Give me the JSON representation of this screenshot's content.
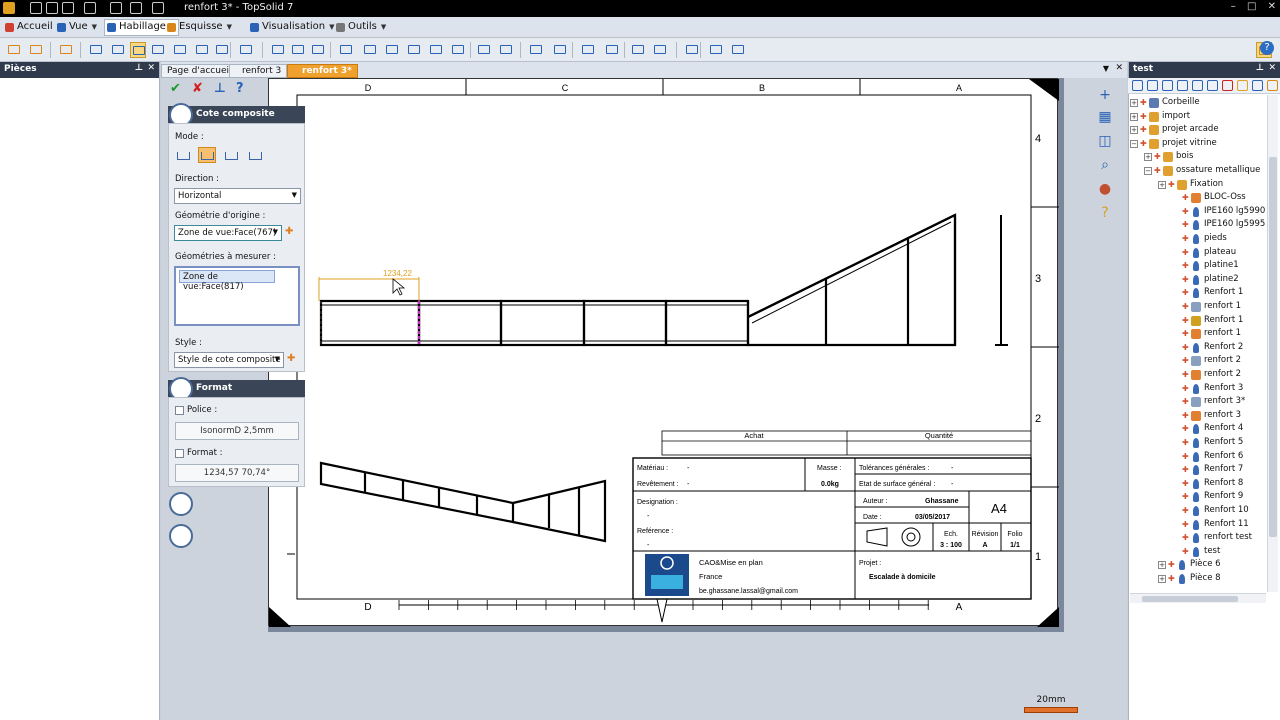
{
  "window": {
    "title": "renfort 3* - TopSolid 7",
    "controls": [
      "–",
      "□",
      "✕"
    ]
  },
  "menubar": [
    {
      "label": "Accueil",
      "color": "#d04030"
    },
    {
      "label": "Vue",
      "color": "#2a62b6"
    },
    {
      "label": "Habillage",
      "color": "#2a62b6",
      "active": true
    },
    {
      "label": "Esquisse",
      "color": "#d9861a"
    },
    {
      "label": "Visualisation",
      "color": "#2a62b6"
    },
    {
      "label": "Outils",
      "color": "#777777"
    }
  ],
  "left_pane": {
    "title": "Pièces"
  },
  "doc_tabs": [
    {
      "label": "Page d'accueil"
    },
    {
      "label": "renfort 3"
    },
    {
      "label": "renfort 3*",
      "active": true
    }
  ],
  "panel": {
    "section1_title": "Cote composite",
    "mode_label": "Mode :",
    "direction_label": "Direction :",
    "direction_value": "Horizontal",
    "origin_label": "Géométrie d'origine :",
    "origin_value": "Zone de vue:Face(767)",
    "measure_label": "Géométries à mesurer :",
    "measure_items": [
      "Zone de vue:Face(817)"
    ],
    "style_label": "Style :",
    "style_value": "Style de cote composite",
    "section2_title": "Format",
    "police_label": "Police :",
    "police_value": "IsonormD 2,5mm",
    "format_label": "Format :",
    "format_value": "1234,57   70,74°"
  },
  "drawing": {
    "dimension_text": "1234,22",
    "top_letters": [
      "D",
      "C",
      "B",
      "A"
    ],
    "bottom_letters": [
      "D",
      "A"
    ],
    "row_numbers": [
      "4",
      "3",
      "2",
      "1"
    ],
    "achat": "Achat",
    "quantite": "Quantité",
    "materiau_label": "Matériau :",
    "materiau_value": "-",
    "revetement_label": "Revêtement :",
    "revetement_value": "-",
    "masse_label": "Masse :",
    "masse_value": "0.0kg",
    "tolerances_label": "Tolérances générales :",
    "tolerances_value": "-",
    "etat_label": "Etat de surface général :",
    "etat_value": "-",
    "designation_label": "Designation :",
    "designation_value": "-",
    "reference_label": "Reférence :",
    "reference_value": "-",
    "auteur_label": "Auteur :",
    "auteur_value": "Ghassane",
    "date_label": "Date :",
    "date_value": "03/05/2017",
    "format_size": "A4",
    "ech_label": "Ech.",
    "ech_value": "3 : 100",
    "revision_label": "Révision",
    "revision_value": "A",
    "folio_label": "Folio",
    "folio_value": "1/1",
    "company_line1": "CAO&Mise en plan",
    "company_line2": "France",
    "company_email": "be.ghassane.lassal@gmail.com",
    "projet_label": "Projet :",
    "projet_value": "Escalade à domicile"
  },
  "scale_bar": {
    "label": "20mm"
  },
  "tree": {
    "pane_title": "test",
    "items": [
      {
        "label": "Corbeille",
        "depth": 0,
        "exp": "+",
        "icon": "trash"
      },
      {
        "label": "import",
        "depth": 0,
        "exp": "+",
        "icon": "folder"
      },
      {
        "label": "projet arcade",
        "depth": 0,
        "exp": "+",
        "icon": "folder"
      },
      {
        "label": "projet vitrine",
        "depth": 0,
        "exp": "-",
        "icon": "folder"
      },
      {
        "label": "bois",
        "depth": 1,
        "exp": "+",
        "icon": "folder"
      },
      {
        "label": "ossature metallique",
        "depth": 1,
        "exp": "-",
        "icon": "folder"
      },
      {
        "label": "Fixation",
        "depth": 2,
        "exp": "+",
        "icon": "folder"
      },
      {
        "label": "BLOC-Oss",
        "depth": 3,
        "exp": "",
        "icon": "block"
      },
      {
        "label": "IPE160 lg5990",
        "depth": 3,
        "exp": "",
        "icon": "part"
      },
      {
        "label": "IPE160 lg5995",
        "depth": 3,
        "exp": "",
        "icon": "part"
      },
      {
        "label": "pieds",
        "depth": 3,
        "exp": "",
        "icon": "part"
      },
      {
        "label": "plateau",
        "depth": 3,
        "exp": "",
        "icon": "part"
      },
      {
        "label": "platine1",
        "depth": 3,
        "exp": "",
        "icon": "part"
      },
      {
        "label": "platine2",
        "depth": 3,
        "exp": "",
        "icon": "part"
      },
      {
        "label": "Renfort 1",
        "depth": 3,
        "exp": "",
        "icon": "part"
      },
      {
        "label": "renfort 1",
        "depth": 3,
        "exp": "",
        "icon": "draw"
      },
      {
        "label": "Renfort 1",
        "depth": 3,
        "exp": "",
        "icon": "warn"
      },
      {
        "label": "renfort 1",
        "depth": 3,
        "exp": "",
        "icon": "block"
      },
      {
        "label": "Renfort 2",
        "depth": 3,
        "exp": "",
        "icon": "part"
      },
      {
        "label": "renfort 2",
        "depth": 3,
        "exp": "",
        "icon": "draw"
      },
      {
        "label": "renfort 2",
        "depth": 3,
        "exp": "",
        "icon": "block"
      },
      {
        "label": "Renfort 3",
        "depth": 3,
        "exp": "",
        "icon": "part"
      },
      {
        "label": "renfort 3*",
        "depth": 3,
        "exp": "",
        "icon": "draw"
      },
      {
        "label": "renfort 3",
        "depth": 3,
        "exp": "",
        "icon": "block"
      },
      {
        "label": "Renfort 4",
        "depth": 3,
        "exp": "",
        "icon": "part"
      },
      {
        "label": "Renfort 5",
        "depth": 3,
        "exp": "",
        "icon": "part"
      },
      {
        "label": "Renfort 6",
        "depth": 3,
        "exp": "",
        "icon": "part"
      },
      {
        "label": "Renfort 7",
        "depth": 3,
        "exp": "",
        "icon": "part"
      },
      {
        "label": "Renfort 8",
        "depth": 3,
        "exp": "",
        "icon": "part"
      },
      {
        "label": "Renfort 9",
        "depth": 3,
        "exp": "",
        "icon": "part"
      },
      {
        "label": "Renfort 10",
        "depth": 3,
        "exp": "",
        "icon": "part"
      },
      {
        "label": "Renfort 11",
        "depth": 3,
        "exp": "",
        "icon": "part"
      },
      {
        "label": "renfort test",
        "depth": 3,
        "exp": "",
        "icon": "part"
      },
      {
        "label": "test",
        "depth": 3,
        "exp": "",
        "icon": "part"
      },
      {
        "label": "Pièce 6",
        "depth": 2,
        "exp": "+",
        "icon": "part"
      },
      {
        "label": "Pièce 8",
        "depth": 2,
        "exp": "+",
        "icon": "part"
      }
    ]
  }
}
